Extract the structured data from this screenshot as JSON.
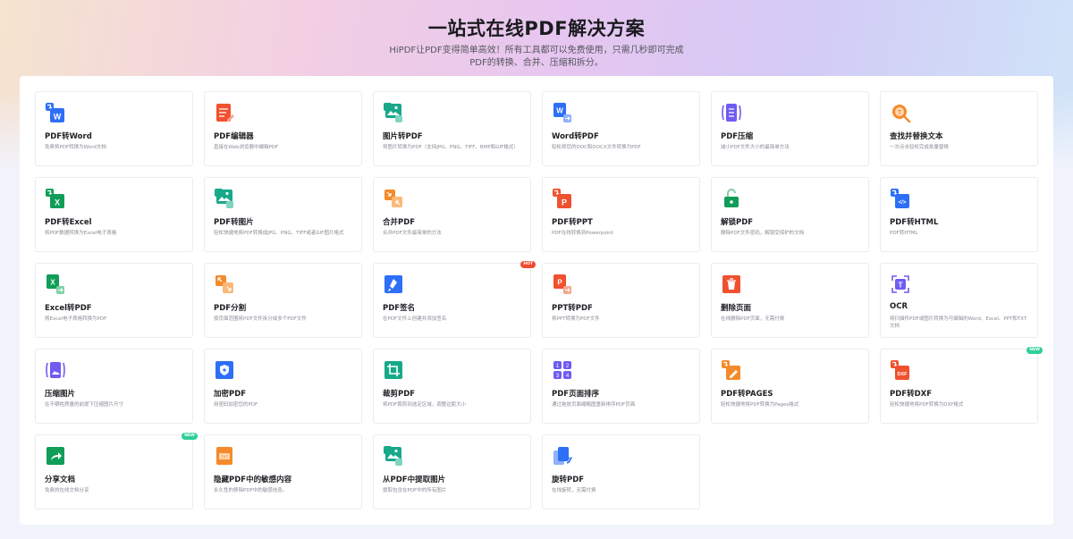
{
  "hero": {
    "title": "一站式在线PDF解决方案",
    "subtitle_line1": "HiPDF让PDF变得简单高效！所有工具都可以免费使用，只需几秒即可完成",
    "subtitle_line2": "PDF的转换、合并、压缩和拆分。"
  },
  "colors": {
    "blue": "#2d6ff7",
    "teal": "#18a88a",
    "green": "#0f9d58",
    "orange": "#f58a2a",
    "red": "#f0512f",
    "purple": "#6f5cf2",
    "badge_hot": "#f04a2f",
    "badge_new": "#2ecf9a"
  },
  "tools": [
    {
      "name": "PDF转Word",
      "desc": "免费将PDF转换为Word文档",
      "icon": "pdf-to-word-icon",
      "kind": "word2",
      "color": "#2d6ff7"
    },
    {
      "name": "PDF编辑器",
      "desc": "直接在Web浏览器中编辑PDF",
      "icon": "pdf-editor-icon",
      "kind": "edit",
      "color": "#f0512f"
    },
    {
      "name": "图片转PDF",
      "desc": "将图片转换为PDF（支持JPG、PNG、TIFF、BMP和GIF格式）",
      "icon": "image-to-pdf-icon",
      "kind": "img2",
      "color": "#18a88a"
    },
    {
      "name": "Word转PDF",
      "desc": "轻松将您的DOC和DOCX文件转换为PDF",
      "icon": "word-to-pdf-icon",
      "kind": "word",
      "color": "#2d6ff7"
    },
    {
      "name": "PDF压缩",
      "desc": "减小PDF文件大小的最简单方法",
      "icon": "compress-pdf-icon",
      "kind": "compress",
      "color": "#6f5cf2"
    },
    {
      "name": "查找并替换文本",
      "desc": "一次点击轻松完成批量替换",
      "icon": "find-replace-icon",
      "kind": "find",
      "color": "#f58a2a"
    },
    {
      "name": "PDF转Excel",
      "desc": "将PDF数据转换为Excel电子表格",
      "icon": "pdf-to-excel-icon",
      "kind": "excel2",
      "color": "#0f9d58"
    },
    {
      "name": "PDF转图片",
      "desc": "轻松快捷地将PDF转换成JPG、PNG、TIFF或者GIF图片格式",
      "icon": "pdf-to-image-icon",
      "kind": "img2",
      "color": "#18a88a"
    },
    {
      "name": "合并PDF",
      "desc": "合并PDF文件最简单的方法",
      "icon": "merge-pdf-icon",
      "kind": "merge",
      "color": "#f58a2a"
    },
    {
      "name": "PDF转PPT",
      "desc": "PDF在线转换到Powerpoint",
      "icon": "pdf-to-ppt-icon",
      "kind": "ppt2",
      "color": "#f0512f"
    },
    {
      "name": "解锁PDF",
      "desc": "删除PDF文件密码，解锁受保护的文档",
      "icon": "unlock-pdf-icon",
      "kind": "unlock",
      "color": "#0f9d58"
    },
    {
      "name": "PDF转HTML",
      "desc": "PDF转HTML",
      "icon": "pdf-to-html-icon",
      "kind": "html",
      "color": "#2d6ff7"
    },
    {
      "name": "Excel转PDF",
      "desc": "将Excel电子表格转换为PDF",
      "icon": "excel-to-pdf-icon",
      "kind": "excel",
      "color": "#0f9d58"
    },
    {
      "name": "PDF分割",
      "desc": "按页面范围将PDF文件拆分成多个PDF文件",
      "icon": "split-pdf-icon",
      "kind": "split",
      "color": "#f58a2a"
    },
    {
      "name": "PDF签名",
      "desc": "在PDF文件上创建并添加签名",
      "icon": "sign-pdf-icon",
      "kind": "sign",
      "color": "#2d6ff7",
      "badge": "HOT"
    },
    {
      "name": "PPT转PDF",
      "desc": "将PPT转换为PDF文件",
      "icon": "ppt-to-pdf-icon",
      "kind": "ppt",
      "color": "#f0512f"
    },
    {
      "name": "删除页面",
      "desc": "在线删除PDF页面，无需付费",
      "icon": "delete-pages-icon",
      "kind": "delete",
      "color": "#f0512f"
    },
    {
      "name": "OCR",
      "desc": "将扫描件PDF或图片转换为可编辑的Word、Excel、PPT和TXT文档",
      "icon": "ocr-icon",
      "kind": "ocr",
      "color": "#6f5cf2"
    },
    {
      "name": "压缩图片",
      "desc": "在不牺牲质量的前提下压缩图片尺寸",
      "icon": "compress-image-icon",
      "kind": "cimg",
      "color": "#6f5cf2"
    },
    {
      "name": "加密PDF",
      "desc": "用密码加密您的PDF",
      "icon": "protect-pdf-icon",
      "kind": "protect",
      "color": "#2d6ff7"
    },
    {
      "name": "裁剪PDF",
      "desc": "将PDF裁剪到选定区域，调整边距大小",
      "icon": "crop-pdf-icon",
      "kind": "crop",
      "color": "#18a88a"
    },
    {
      "name": "PDF页面排序",
      "desc": "通过拖放页面缩略图重新排序PDF页面",
      "icon": "reorder-pages-icon",
      "kind": "order",
      "color": "#6f5cf2"
    },
    {
      "name": "PDF转PAGES",
      "desc": "轻松快捷地将PDF转换为Pages格式",
      "icon": "pdf-to-pages-icon",
      "kind": "pages",
      "color": "#f58a2a"
    },
    {
      "name": "PDF转DXF",
      "desc": "轻松快捷地将PDF转换为DXF格式",
      "icon": "pdf-to-dxf-icon",
      "kind": "dxf",
      "color": "#f0512f",
      "badge": "NEW"
    },
    {
      "name": "分享文档",
      "desc": "免费的在线文档分享",
      "icon": "share-document-icon",
      "kind": "share",
      "color": "#0f9d58",
      "badge": "NEW"
    },
    {
      "name": "隐藏PDF中的敏感内容",
      "desc": "永久性的移除PDF中的敏感信息。",
      "icon": "redact-pdf-icon",
      "kind": "redact",
      "color": "#f58a2a"
    },
    {
      "name": "从PDF中提取图片",
      "desc": "提取包含在PDF中的所有图片",
      "icon": "extract-images-icon",
      "kind": "img2",
      "color": "#18a88a"
    },
    {
      "name": "旋转PDF",
      "desc": "在线旋转，无需付费",
      "icon": "rotate-pdf-icon",
      "kind": "rotate",
      "color": "#2d6ff7"
    }
  ]
}
